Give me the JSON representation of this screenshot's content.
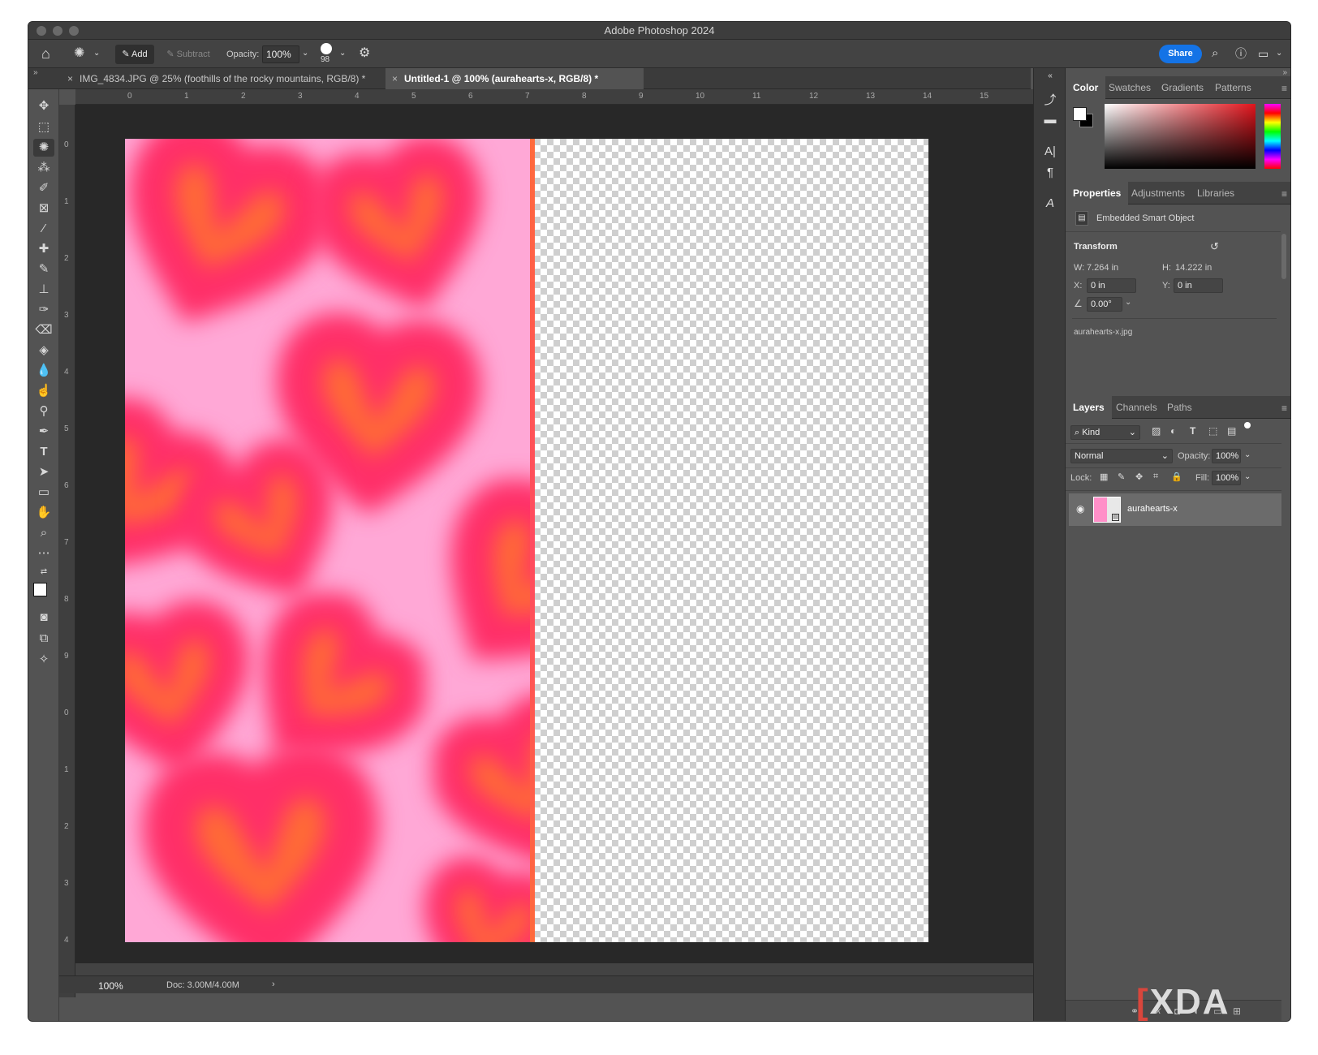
{
  "window": {
    "title": "Adobe Photoshop 2024"
  },
  "options_bar": {
    "tool_icon": "quick-selection-icon",
    "add_label": "Add",
    "subtract_label": "Subtract",
    "opacity_label": "Opacity:",
    "opacity_value": "100%",
    "brush_size": "98",
    "share_label": "Share"
  },
  "tabs": [
    {
      "label": "IMG_4834.JPG @ 25% (foothills of the rocky mountains, RGB/8) *",
      "active": false
    },
    {
      "label": "Untitled-1 @ 100% (aurahearts-x, RGB/8) *",
      "active": true
    }
  ],
  "ruler": {
    "h": [
      "0",
      "1",
      "2",
      "3",
      "4",
      "5",
      "6",
      "7",
      "8",
      "9",
      "10",
      "11",
      "12",
      "13",
      "14",
      "15"
    ],
    "v": [
      "0",
      "1",
      "2",
      "3",
      "4",
      "5",
      "6",
      "7",
      "8",
      "9",
      "0",
      "1",
      "2",
      "3",
      "4"
    ]
  },
  "color_panel": {
    "tabs": [
      "Color",
      "Swatches",
      "Gradients",
      "Patterns"
    ],
    "accent": "#e0141c"
  },
  "properties_panel": {
    "tabs": [
      "Properties",
      "Adjustments",
      "Libraries"
    ],
    "object_type": "Embedded Smart Object",
    "section": "Transform",
    "w_label": "W:",
    "w_value": "7.264 in",
    "h_label": "H:",
    "h_value": "14.222 in",
    "x_label": "X:",
    "x_value": "0 in",
    "y_label": "Y:",
    "y_value": "0 in",
    "angle_value": "0.00°",
    "filename": "aurahearts-x.jpg"
  },
  "layers_panel": {
    "tabs": [
      "Layers",
      "Channels",
      "Paths"
    ],
    "filter": "Kind",
    "blend_mode": "Normal",
    "opacity_label": "Opacity:",
    "opacity_value": "100%",
    "lock_label": "Lock:",
    "fill_label": "Fill:",
    "fill_value": "100%",
    "layers": [
      {
        "name": "aurahearts-x",
        "visible": true
      }
    ]
  },
  "status_bar": {
    "zoom": "100%",
    "doc": "Doc: 3.00M/4.00M"
  },
  "watermark": "XDA"
}
